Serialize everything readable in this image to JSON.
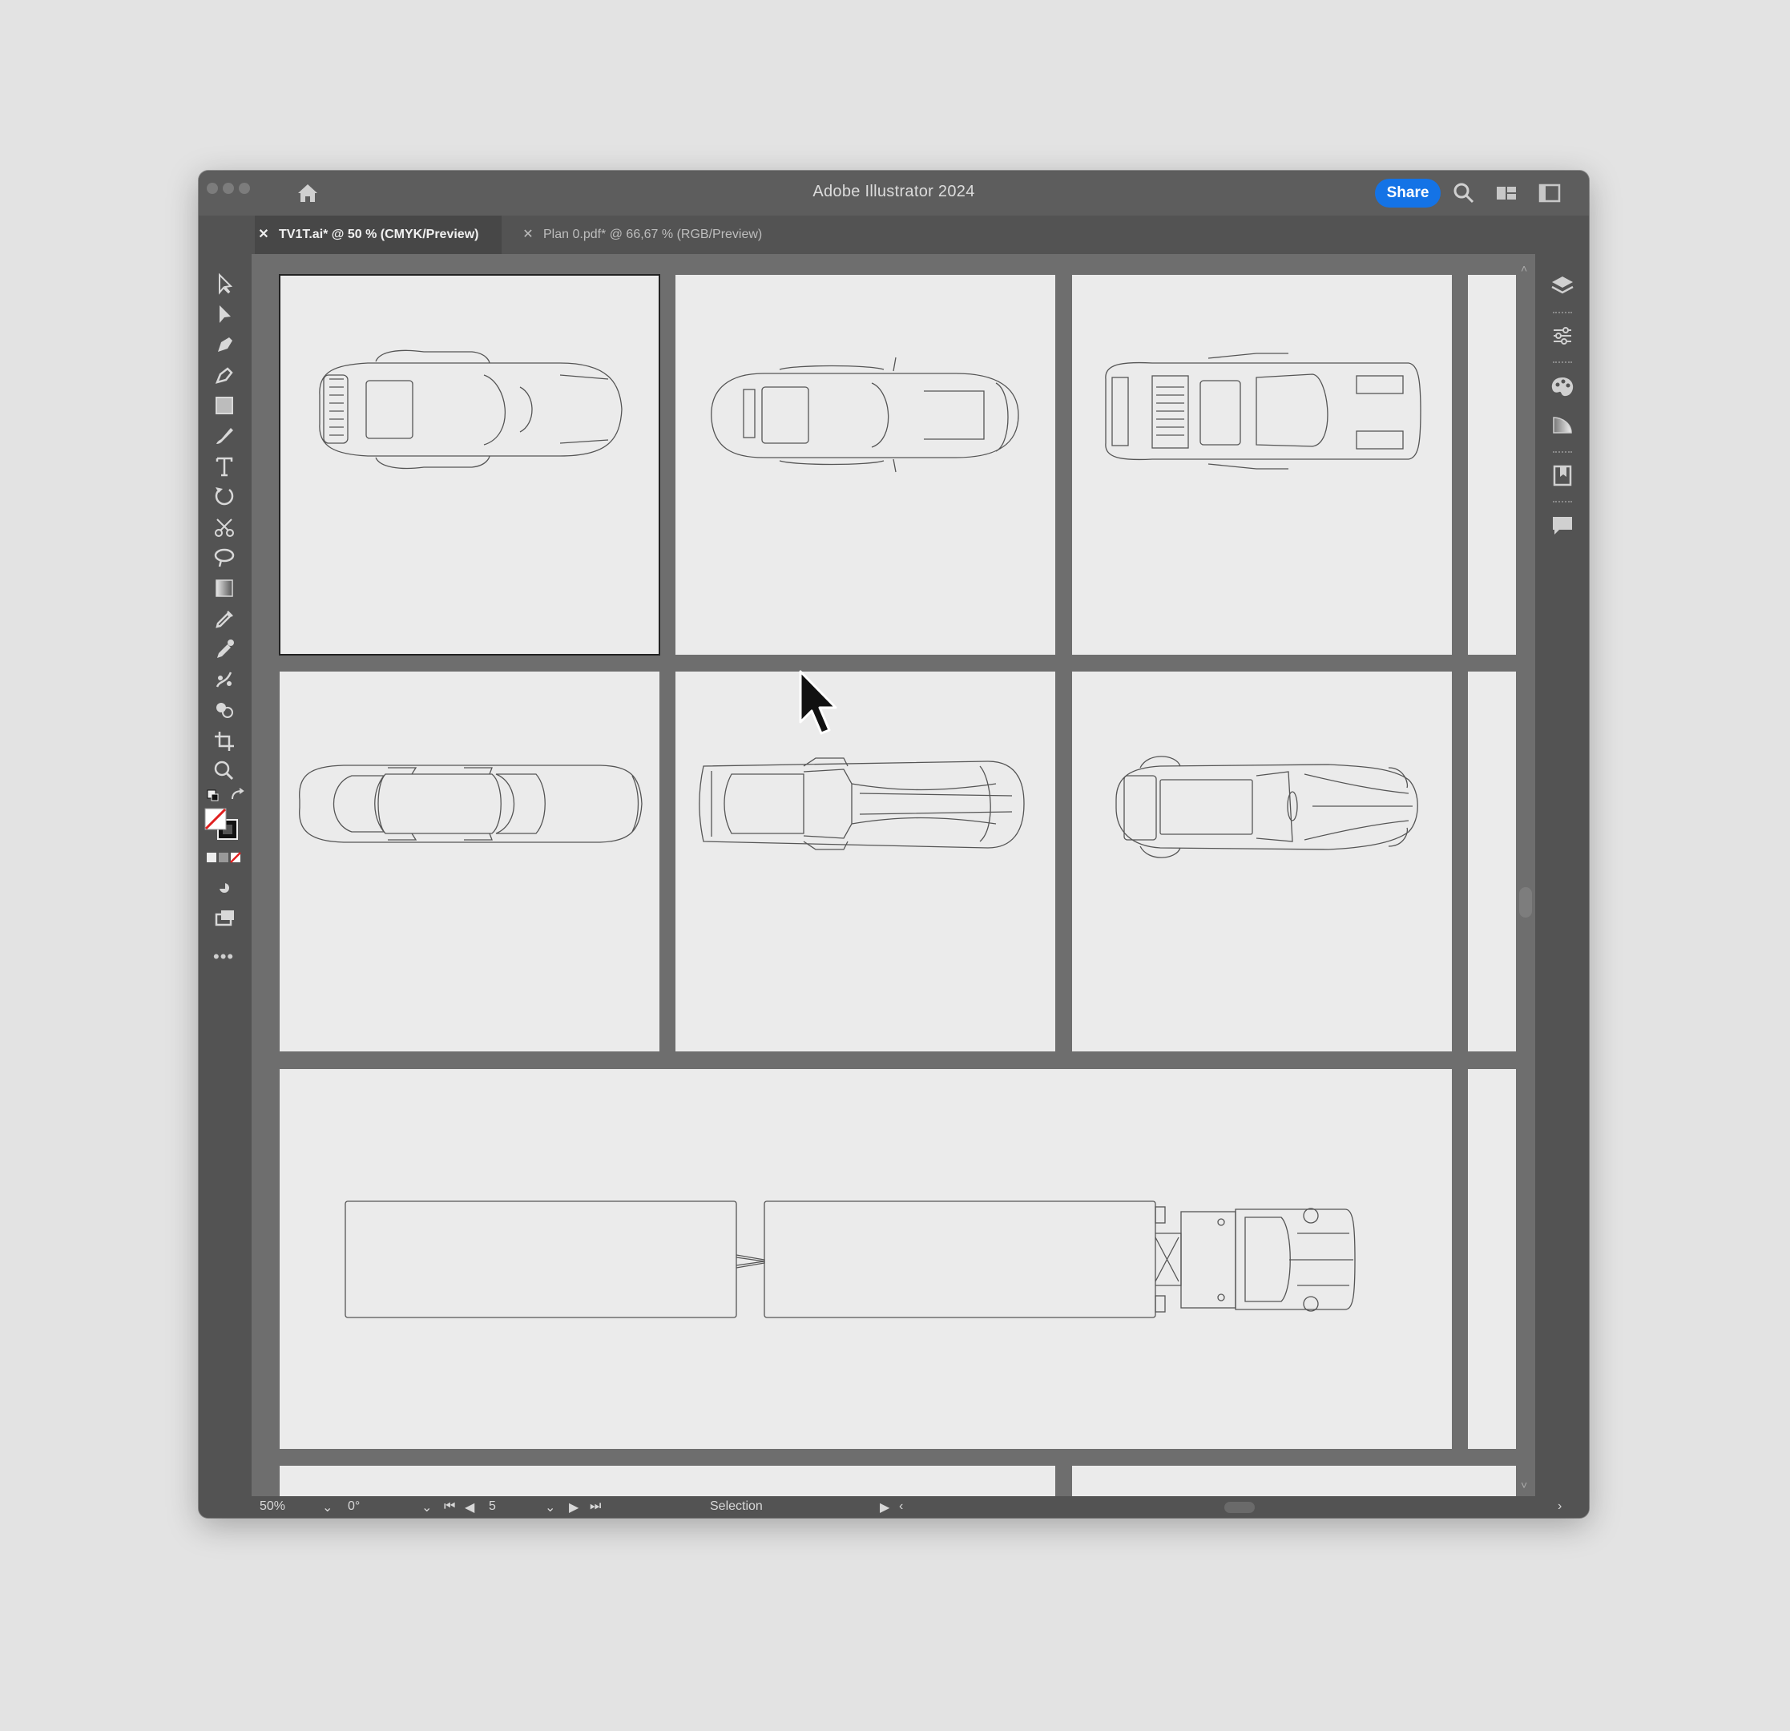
{
  "window": {
    "title": "Adobe Illustrator 2024",
    "share_label": "Share"
  },
  "tabs": [
    {
      "label": "TV1T.ai* @ 50 % (CMYK/Preview)",
      "active": true
    },
    {
      "label": "Plan 0.pdf* @ 66,67 % (RGB/Preview)",
      "active": false
    }
  ],
  "toolbar": {
    "tools": [
      "selection-tool",
      "direct-selection-tool",
      "pen-tool",
      "curvature-tool",
      "rectangle-tool",
      "paintbrush-tool",
      "type-tool",
      "rotate-tool",
      "scissors-tool",
      "lasso-tool",
      "gradient-tool",
      "eyedropper-tool",
      "color-picker-tool",
      "puppet-warp-tool",
      "shape-builder-tool",
      "artboard-tool",
      "zoom-tool"
    ],
    "more_label": "•••"
  },
  "artboards": [
    {
      "subject": "car-top-view-1"
    },
    {
      "subject": "car-top-view-2"
    },
    {
      "subject": "car-top-view-3"
    },
    {
      "subject": "car-top-view-4"
    },
    {
      "subject": "car-top-view-5"
    },
    {
      "subject": "car-top-view-6"
    },
    {
      "subject": "truck-trailer-top-view"
    }
  ],
  "status": {
    "zoom": "50%",
    "rotation": "0°",
    "artboard_number": "5",
    "tool_name": "Selection"
  },
  "colors": {
    "accent": "#1473e6",
    "canvas": "#6e6e6e",
    "artboard": "#ebebeb",
    "chrome": "#535353"
  }
}
